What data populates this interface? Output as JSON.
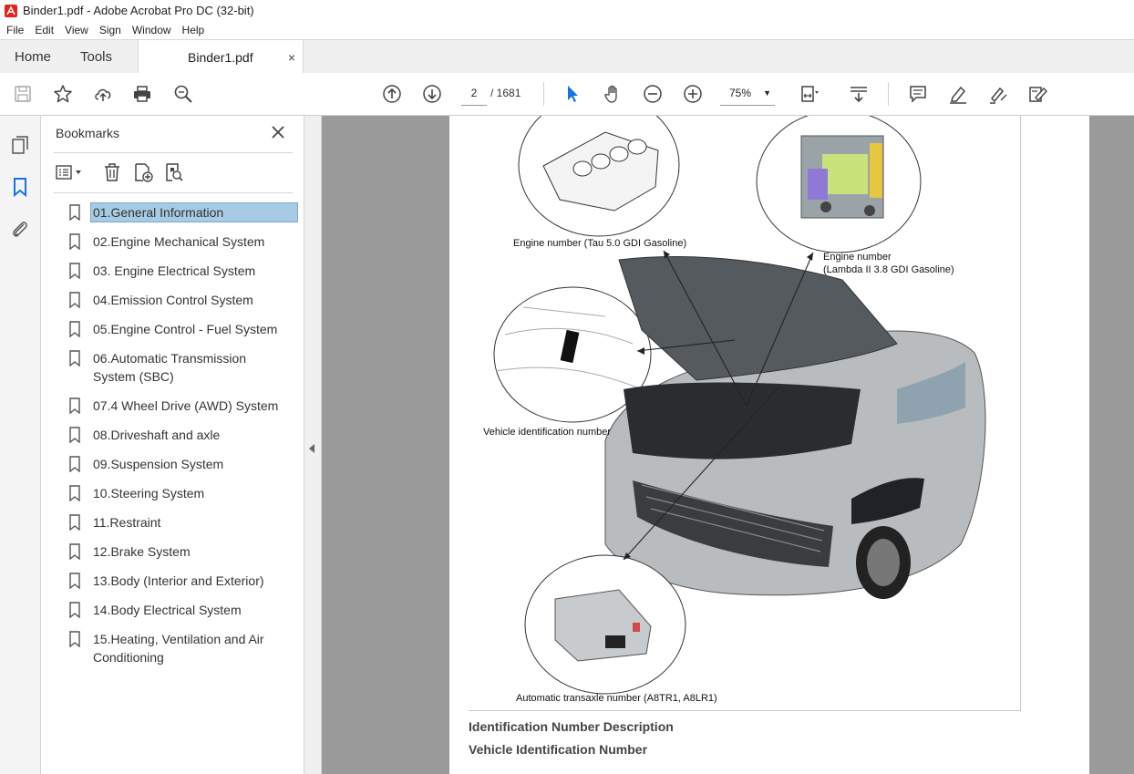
{
  "window": {
    "title": "Binder1.pdf - Adobe Acrobat Pro DC (32-bit)"
  },
  "menu": [
    "File",
    "Edit",
    "View",
    "Sign",
    "Window",
    "Help"
  ],
  "tabs": {
    "home": "Home",
    "tools": "Tools",
    "document": "Binder1.pdf",
    "close": "×"
  },
  "toolbar": {
    "page_current": "2",
    "page_total": "/   1681",
    "zoom": "75%",
    "zoom_caret": "▼"
  },
  "panel": {
    "title": "Bookmarks",
    "bookmarks": [
      "01.General Information",
      "02.Engine Mechanical System",
      "03. Engine Electrical System",
      "04.Emission Control System",
      "05.Engine Control - Fuel System",
      "06.Automatic Transmission System (SBC)",
      "07.4 Wheel Drive (AWD) System",
      "08.Driveshaft and axle",
      "09.Suspension System",
      "10.Steering System",
      "11.Restraint",
      "12.Brake System",
      "13.Body (Interior and Exterior)",
      "14.Body Electrical System",
      "15.Heating, Ventilation and Air Conditioning"
    ]
  },
  "document": {
    "callouts": {
      "tau": "Engine number (Tau 5.0 GDI Gasoline)",
      "lambda_1": "Engine number",
      "lambda_2": "(Lambda II 3.8 GDI Gasoline)",
      "vin": "Vehicle identification number",
      "trans": "Automatic transaxle number (A8TR1, A8LR1)"
    },
    "heading_1": "Identification Number Description",
    "heading_2": "Vehicle Identification Number"
  },
  "colors": {
    "accent": "#1473e6",
    "selection": "#a7cbe4",
    "viewer_bg": "#9a9a9a"
  }
}
